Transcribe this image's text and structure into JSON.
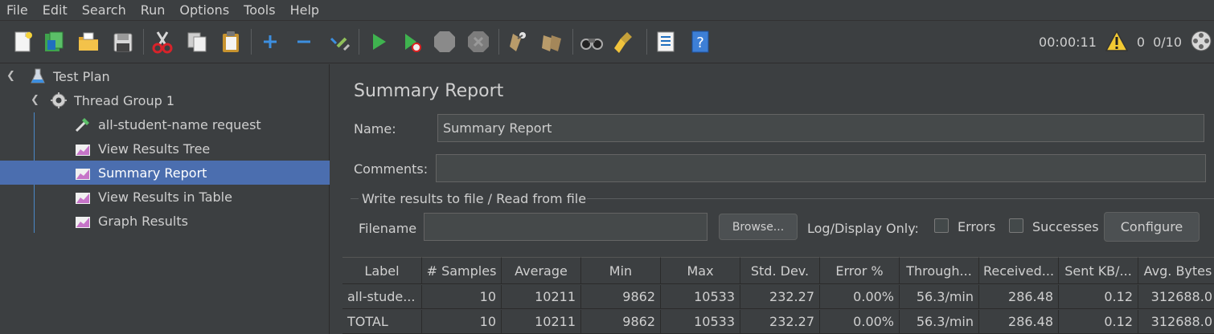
{
  "menu": [
    "File",
    "Edit",
    "Search",
    "Run",
    "Options",
    "Tools",
    "Help"
  ],
  "toolbar": {
    "icons": [
      "new-icon",
      "templates-icon",
      "open-icon",
      "save-icon",
      "cut-icon",
      "copy-icon",
      "paste-icon",
      "expand-icon",
      "collapse-icon",
      "toggle-icon",
      "start-icon",
      "start-no-pauses-icon",
      "stop-icon",
      "shutdown-icon",
      "clear-icon",
      "clear-all-icon",
      "search-icon",
      "reset-search-icon",
      "function-helper-icon",
      "help-icon"
    ],
    "timer": "00:00:11",
    "warnings": "0",
    "threads": "0/10"
  },
  "tree": {
    "items": [
      {
        "label": "Test Plan",
        "icon": "test-plan-icon"
      },
      {
        "label": "Thread Group 1",
        "icon": "thread-group-icon"
      },
      {
        "label": "all-student-name request",
        "icon": "sampler-icon"
      },
      {
        "label": "View Results Tree",
        "icon": "listener-icon"
      },
      {
        "label": "Summary Report",
        "icon": "listener-icon"
      },
      {
        "label": "View Results in Table",
        "icon": "listener-icon"
      },
      {
        "label": "Graph Results",
        "icon": "listener-icon"
      }
    ]
  },
  "panel": {
    "title": "Summary Report",
    "name_label": "Name:",
    "name_value": "Summary Report",
    "comments_label": "Comments:",
    "comments_value": "",
    "file_group_label": "Write results to file / Read from file",
    "filename_label": "Filename",
    "filename_value": "",
    "browse_label": "Browse...",
    "log_display_label": "Log/Display Only:",
    "errors_label": "Errors",
    "successes_label": "Successes",
    "configure_label": "Configure"
  },
  "table": {
    "columns": [
      "Label",
      "# Samples",
      "Average",
      "Min",
      "Max",
      "Std. Dev.",
      "Error %",
      "Through...",
      "Received...",
      "Sent KB/...",
      "Avg. Bytes"
    ],
    "rows": [
      [
        "all-stude...",
        "10",
        "10211",
        "9862",
        "10533",
        "232.27",
        "0.00%",
        "56.3/min",
        "286.48",
        "0.12",
        "312688.0"
      ],
      [
        "TOTAL",
        "10",
        "10211",
        "9862",
        "10533",
        "232.27",
        "0.00%",
        "56.3/min",
        "286.48",
        "0.12",
        "312688.0"
      ]
    ]
  },
  "colors": {
    "background": "#3c3f41",
    "selection": "#4b6eaf",
    "start_green": "#3fb34f",
    "accent_blue": "#3d8fe0"
  }
}
